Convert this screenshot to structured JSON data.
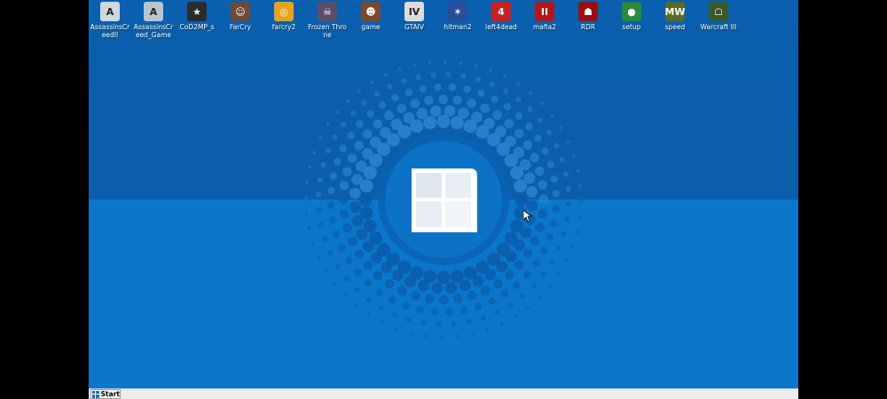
{
  "desktop_icons": [
    {
      "label": "AssassinsCreedII",
      "glyph": "A",
      "color": "#cfd8e0",
      "icon": "assassins-creed-2-icon"
    },
    {
      "label": "AssassinsCreed_Game",
      "glyph": "A",
      "color": "#b9c4cf",
      "icon": "assassins-creed-icon"
    },
    {
      "label": "CoD2MP_s",
      "glyph": "★",
      "color": "#2b2b2b",
      "icon": "cod2-star-icon"
    },
    {
      "label": "FarCry",
      "glyph": "☺",
      "color": "#6b4a3a",
      "icon": "farcry-face-icon"
    },
    {
      "label": "farcry2",
      "glyph": "◎",
      "color": "#e8a21a",
      "icon": "farcry2-icon"
    },
    {
      "label": "Frozen Throne",
      "glyph": "☠",
      "color": "#5a4d6a",
      "icon": "frozen-throne-icon"
    },
    {
      "label": "game",
      "glyph": "☻",
      "color": "#7a4a2a",
      "icon": "game-face-icon"
    },
    {
      "label": "GTAIV",
      "glyph": "IV",
      "color": "#dcdcdc",
      "icon": "gta4-icon"
    },
    {
      "label": "hitman2",
      "glyph": "✶",
      "color": "#2a4e9a",
      "icon": "hitman2-icon"
    },
    {
      "label": "left4dead",
      "glyph": "4",
      "color": "#c82020",
      "icon": "left4dead-icon"
    },
    {
      "label": "mafia2",
      "glyph": "II",
      "color": "#b01818",
      "icon": "mafia2-icon"
    },
    {
      "label": "RDR",
      "glyph": "☗",
      "color": "#9a1010",
      "icon": "rdr-icon"
    },
    {
      "label": "setup",
      "glyph": "●",
      "color": "#2a8a3a",
      "icon": "setup-icon"
    },
    {
      "label": "speed",
      "glyph": "MW",
      "color": "#5a6a2a",
      "icon": "speed-icon"
    },
    {
      "label": "Warcraft III",
      "glyph": "☖",
      "color": "#3a5a2a",
      "icon": "warcraft3-icon"
    }
  ],
  "taskbar": {
    "start_label": "Start"
  }
}
